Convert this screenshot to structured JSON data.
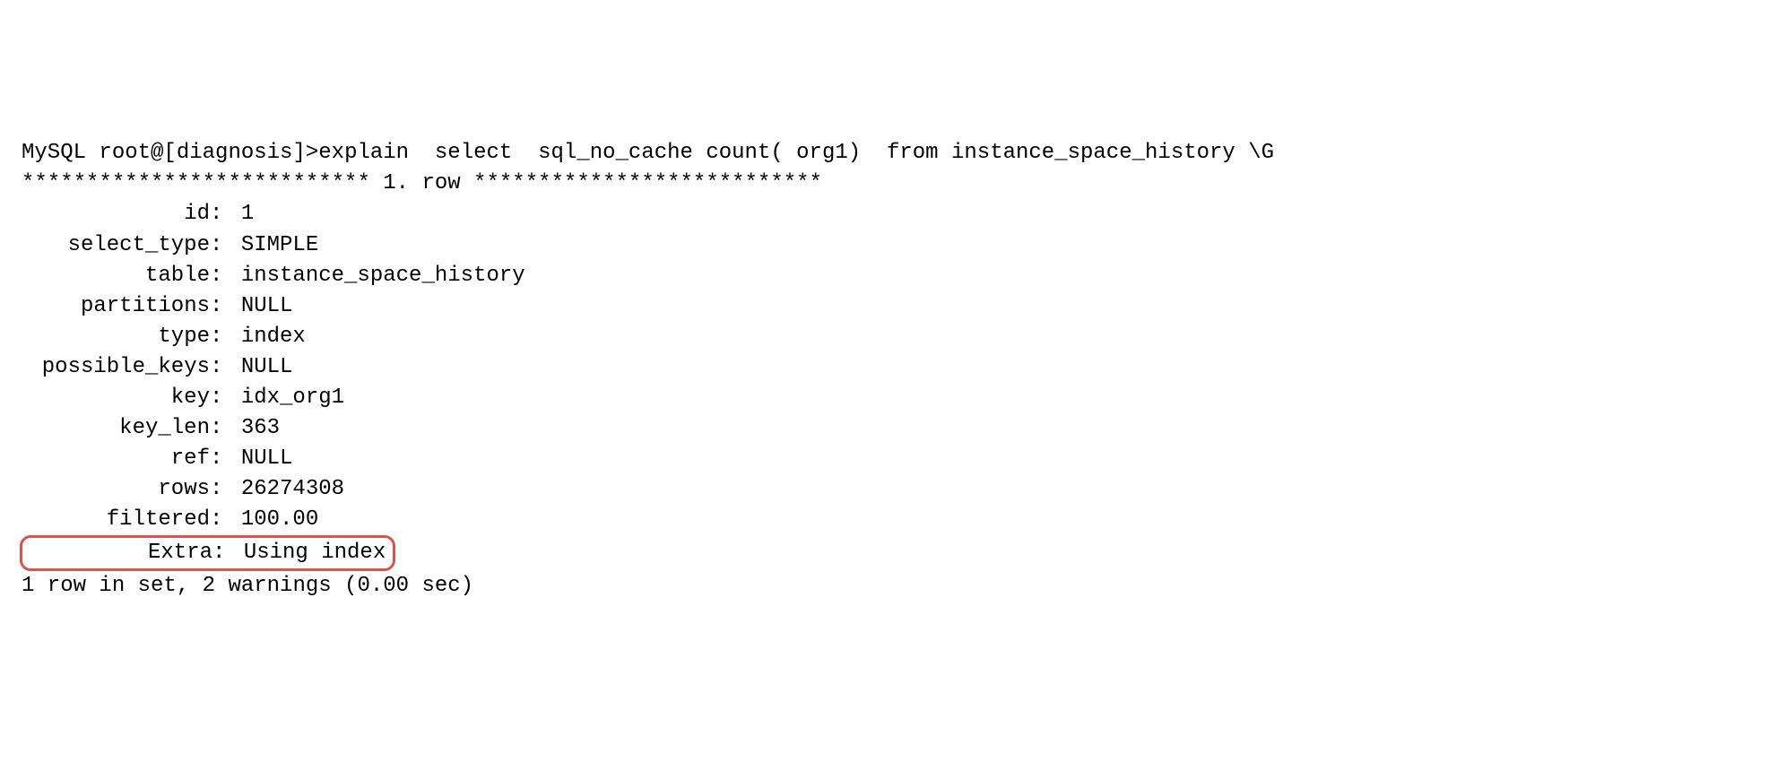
{
  "prompt": {
    "prefix": "MySQL root@[diagnosis]>",
    "command": "explain  select  sql_no_cache count( org1)  from instance_space_history \\G"
  },
  "row_separator": {
    "left": "***************************",
    "label": " 1. row ",
    "right": "***************************"
  },
  "fields": [
    {
      "label": "id",
      "value": "1"
    },
    {
      "label": "select_type",
      "value": "SIMPLE"
    },
    {
      "label": "table",
      "value": "instance_space_history"
    },
    {
      "label": "partitions",
      "value": "NULL"
    },
    {
      "label": "type",
      "value": "index"
    },
    {
      "label": "possible_keys",
      "value": "NULL"
    },
    {
      "label": "key",
      "value": "idx_org1"
    },
    {
      "label": "key_len",
      "value": "363"
    },
    {
      "label": "ref",
      "value": "NULL"
    },
    {
      "label": "rows",
      "value": "26274308"
    },
    {
      "label": "filtered",
      "value": "100.00"
    },
    {
      "label": "Extra",
      "value": "Using index"
    }
  ],
  "footer": "1 row in set, 2 warnings (0.00 sec)"
}
